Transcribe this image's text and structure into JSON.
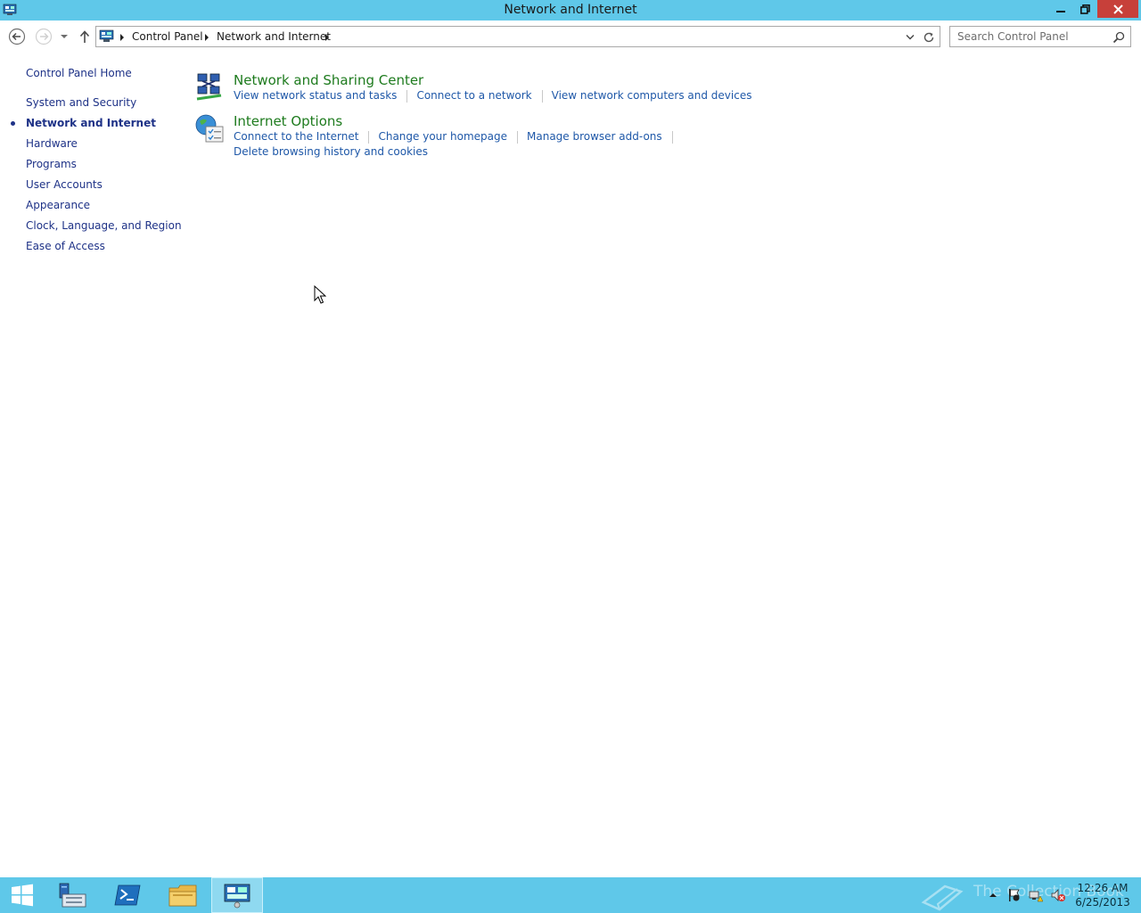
{
  "window": {
    "title": "Network and Internet"
  },
  "address_bar": {
    "crumbs": [
      "Control Panel",
      "Network and Internet"
    ]
  },
  "search": {
    "placeholder": "Search Control Panel"
  },
  "left_nav": {
    "items": [
      {
        "label": "Control Panel Home"
      },
      {
        "label": "System and Security"
      },
      {
        "label": "Network and Internet",
        "active": true
      },
      {
        "label": "Hardware"
      },
      {
        "label": "Programs"
      },
      {
        "label": "User Accounts"
      },
      {
        "label": "Appearance"
      },
      {
        "label": "Clock, Language, and Region"
      },
      {
        "label": "Ease of Access"
      }
    ]
  },
  "categories": [
    {
      "title": "Network and Sharing Center",
      "icon": "network-sharing-icon",
      "tasks": [
        "View network status and tasks",
        "Connect to a network",
        "View network computers and devices"
      ]
    },
    {
      "title": "Internet Options",
      "icon": "internet-options-icon",
      "tasks": [
        "Connect to the Internet",
        "Change your homepage",
        "Manage browser add-ons"
      ],
      "tasks_line2": [
        "Delete browsing history and cookies"
      ]
    }
  ],
  "taskbar": {
    "clock_time": "12:26 AM",
    "clock_date": "6/25/2013",
    "watermark_text": "The Collection Book",
    "pinned": [
      "start-icon",
      "server-manager-icon",
      "powershell-icon",
      "file-explorer-icon",
      "control-panel-icon"
    ]
  },
  "colors": {
    "titlebar": "#5fc8e9",
    "close_button": "#c7403a",
    "category_title": "#1e7b1e",
    "task_link": "#1f58a8",
    "nav_link": "#1e3287"
  }
}
